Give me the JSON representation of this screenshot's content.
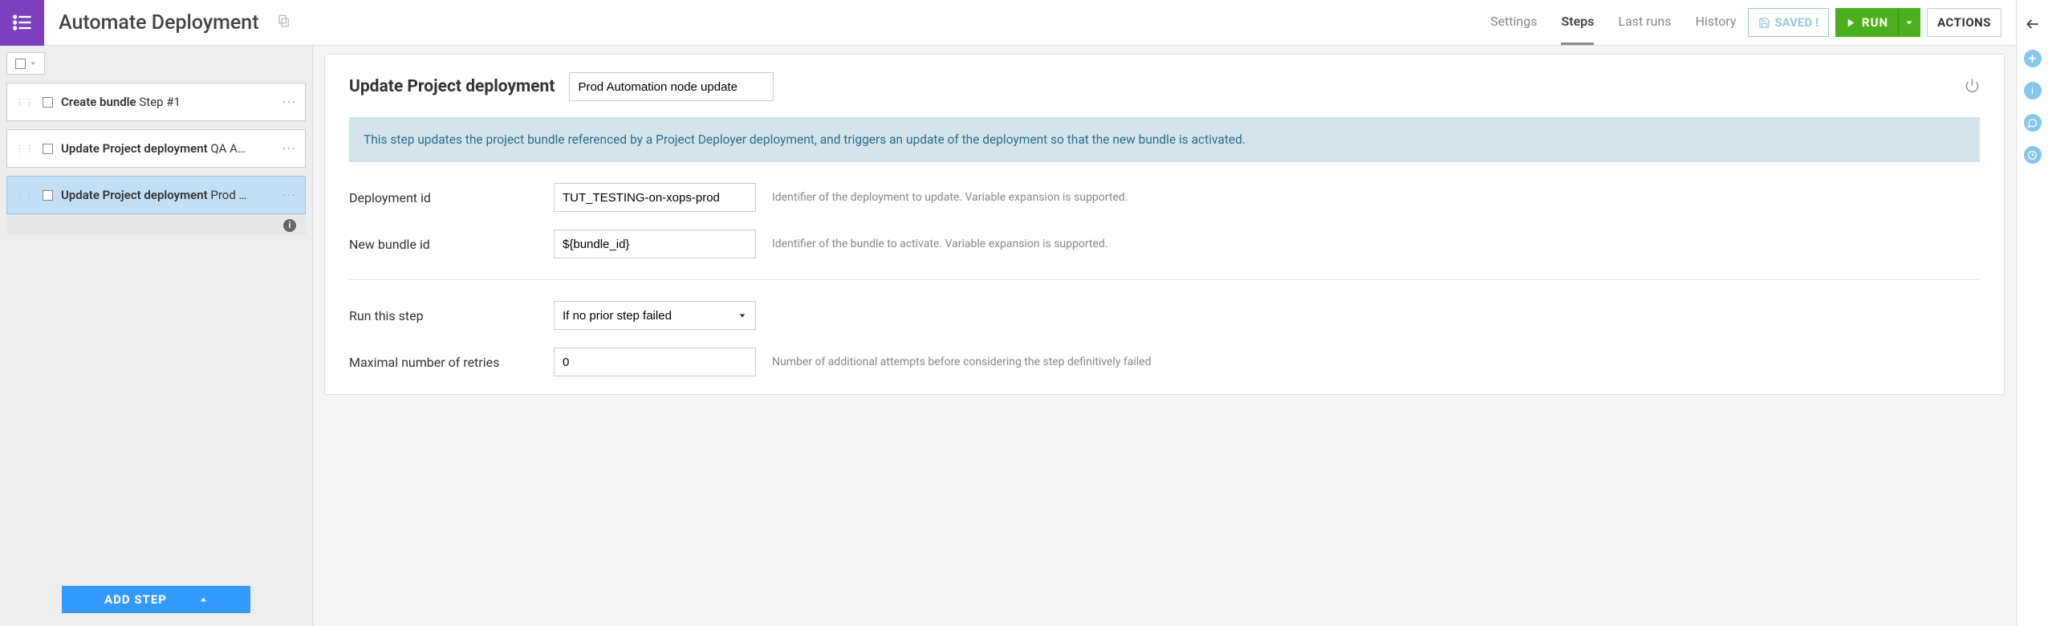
{
  "header": {
    "title": "Automate Deployment",
    "tabs": {
      "settings": "Settings",
      "steps": "Steps",
      "lastruns": "Last runs",
      "history": "History"
    },
    "buttons": {
      "saved": "SAVED !",
      "run": "RUN",
      "actions": "ACTIONS"
    }
  },
  "sidebar": {
    "steps": [
      {
        "name": "Create bundle",
        "sub": "Step #1"
      },
      {
        "name": "Update Project deployment",
        "sub": "QA A…"
      },
      {
        "name": "Update Project deployment",
        "sub": "Prod …"
      }
    ],
    "add_label": "ADD STEP"
  },
  "editor": {
    "panel_title": "Update Project deployment",
    "panel_name": "Prod Automation node update",
    "note": "This step updates the project bundle referenced by a Project Deployer deployment, and triggers an update of the deployment so that the new bundle is activated.",
    "fields": {
      "deployment_id": {
        "label": "Deployment id",
        "value": "TUT_TESTING-on-xops-prod",
        "help": "Identifier of the deployment to update. Variable expansion is supported."
      },
      "new_bundle_id": {
        "label": "New bundle id",
        "value": "${bundle_id}",
        "help": "Identifier of the bundle to activate. Variable expansion is supported."
      },
      "run_step": {
        "label": "Run this step",
        "value": "If no prior step failed"
      },
      "max_retries": {
        "label": "Maximal number of retries",
        "value": "0",
        "help": "Number of additional attempts before considering the step definitively failed"
      }
    }
  }
}
